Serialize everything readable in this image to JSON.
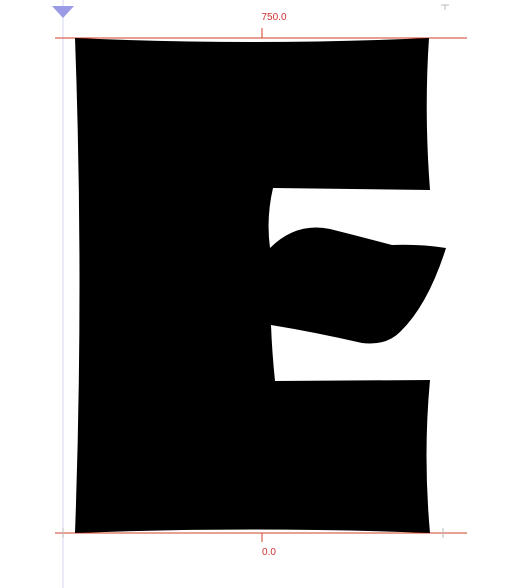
{
  "metrics": {
    "top_label": "750.0",
    "bottom_label": "0.0"
  },
  "colors": {
    "metric_line": "#d0422a",
    "metric_text": "#cc3333",
    "guide_line": "#d6d6f0",
    "anchor_marker": "#9a9ae6",
    "glyph_fill": "#000000",
    "canvas_background": "#ffffff",
    "tick": "#b8b8b8"
  },
  "glyph": {
    "name": "E"
  },
  "icons": {
    "anchor_marker": "triangle-down-icon",
    "corner_tick": "tick-mark-icon"
  }
}
